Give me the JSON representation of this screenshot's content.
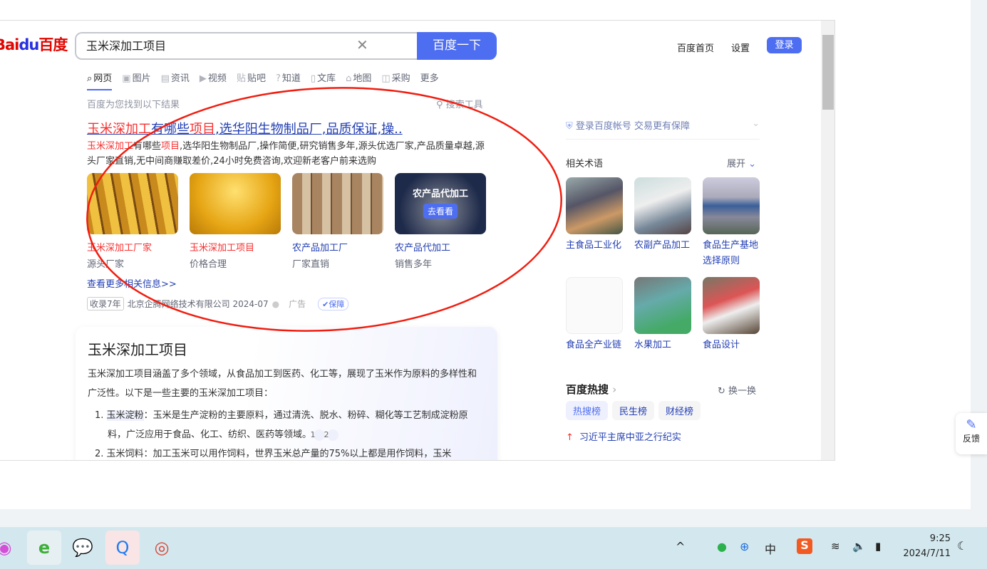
{
  "header": {
    "logo": "Bai百度",
    "search_value": "玉米深加工项目",
    "search_button": "百度一下",
    "links": [
      "百度首页",
      "设置"
    ],
    "login": "登录"
  },
  "tabs": [
    {
      "icon": "search-icon",
      "label": "网页"
    },
    {
      "icon": "image-icon",
      "label": "图片"
    },
    {
      "icon": "news-icon",
      "label": "资讯"
    },
    {
      "icon": "video-icon",
      "label": "视频"
    },
    {
      "icon": "tieba-icon",
      "label": "贴吧"
    },
    {
      "icon": "question-icon",
      "label": "知道"
    },
    {
      "icon": "doc-icon",
      "label": "文库"
    },
    {
      "icon": "map-icon",
      "label": "地图"
    },
    {
      "icon": "shop-icon",
      "label": "采购"
    },
    {
      "label": "更多"
    }
  ],
  "result_info": "百度为您找到以下结果",
  "search_tools": "搜索工具",
  "ad": {
    "title_red": "玉米深加工",
    "title_blue": "有哪些",
    "title_red2": "项目",
    "title_rest": ",选华阳生物制品厂,品质保证,操..",
    "desc_red": "玉米深加工",
    "desc_1": "有哪些",
    "desc_red2": "项目",
    "desc_2": ",选华阳生物制品厂,操作简便,研究销售多年,源头优选厂家,产品质量卓越,源头厂家直销,无中间商赚取差价,24小时免费咨询,欢迎新老客户前来选购",
    "thumbs": [
      {
        "title": "玉米深加工厂家",
        "sub": "源头厂家"
      },
      {
        "title": "玉米深加工项目",
        "sub": "价格合理"
      },
      {
        "title": "农产品加工厂",
        "sub": "厂家直销"
      },
      {
        "title": "农产品代加工",
        "sub": "销售多年",
        "overlay": "农产品代加工",
        "button": "去看看"
      }
    ],
    "more": "查看更多相关信息>>",
    "badge": "收录7年",
    "company": "北京企腾网络技术有限公司 2024-07",
    "ad_label": "广告",
    "guarantee": "保障"
  },
  "ai_card": {
    "title": "玉米深加工项目",
    "intro": "玉米深加工项目涵盖了多个领域，从食品加工到医药、化工等，展现了玉米作为原料的多样性和广泛性。以下是一些主要的玉米深加工项目：",
    "item1_num": "1.",
    "item1_term": "玉米淀粉",
    "item1_text": "：玉米是生产淀粉的主要原料，通过清洗、脱水、粉碎、糊化等工艺制成淀粉原料，广泛应用于食品、化工、纺织、医药等领域。",
    "cites": [
      "1",
      "2"
    ],
    "item2_partial": "2.  玉米饲料：加工玉米可以用作饲料，世界玉米总产量的75%以上都是用作饲料，玉米"
  },
  "sidebar": {
    "login_tip": "登录百度帐号 交易更有保障",
    "related_title": "相关术语",
    "expand": "展开",
    "related": [
      "主食品工业化",
      "农副产品加工",
      "食品生产基地选择原则",
      "食品全产业链",
      "水果加工",
      "食品设计"
    ],
    "hot_title": "百度热搜",
    "refresh": "换一换",
    "chips": [
      "热搜榜",
      "民生榜",
      "财经榜"
    ],
    "hot_item": "习近平主席中亚之行纪实"
  },
  "feedback": "反馈",
  "taskbar": {
    "time": "9:25",
    "date": "2024/7/11",
    "ime": "中"
  }
}
